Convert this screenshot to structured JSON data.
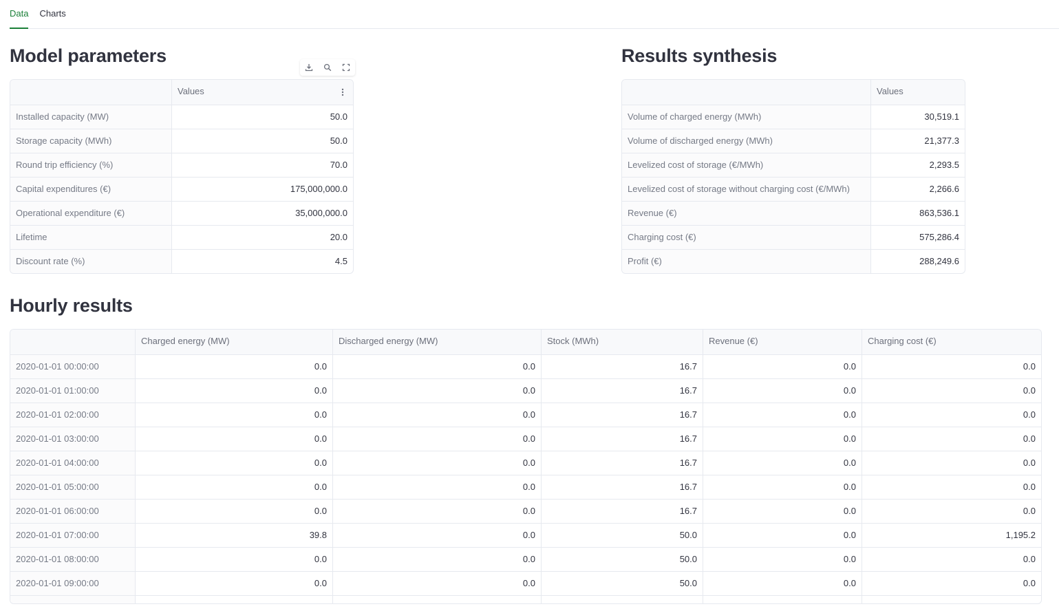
{
  "tabs": [
    {
      "label": "Data",
      "active": true
    },
    {
      "label": "Charts",
      "active": false
    }
  ],
  "accent_color": "#1a7f37",
  "model_parameters": {
    "title": "Model parameters",
    "header": [
      "",
      "Values"
    ],
    "rows": [
      {
        "label": "Installed capacity (MW)",
        "value": "50.0"
      },
      {
        "label": "Storage capacity (MWh)",
        "value": "50.0"
      },
      {
        "label": "Round trip efficiency (%)",
        "value": "70.0"
      },
      {
        "label": "Capital expenditures (€)",
        "value": "175,000,000.0"
      },
      {
        "label": "Operational expenditure (€)",
        "value": "35,000,000.0"
      },
      {
        "label": "Lifetime",
        "value": "20.0"
      },
      {
        "label": "Discount rate (%)",
        "value": "4.5"
      }
    ],
    "toolbar_icons": [
      "download-icon",
      "search-icon",
      "fullscreen-icon"
    ]
  },
  "results_synthesis": {
    "title": "Results synthesis",
    "header": [
      "",
      "Values"
    ],
    "rows": [
      {
        "label": "Volume of charged energy (MWh)",
        "value": "30,519.1"
      },
      {
        "label": "Volume of discharged energy (MWh)",
        "value": "21,377.3"
      },
      {
        "label": "Levelized cost of storage (€/MWh)",
        "value": "2,293.5"
      },
      {
        "label": "Levelized cost of storage without charging cost (€/MWh)",
        "value": "2,266.6"
      },
      {
        "label": "Revenue (€)",
        "value": "863,536.1"
      },
      {
        "label": "Charging cost (€)",
        "value": "575,286.4"
      },
      {
        "label": "Profit (€)",
        "value": "288,249.6"
      }
    ]
  },
  "hourly_results": {
    "title": "Hourly results",
    "columns": [
      "",
      "Charged energy (MW)",
      "Discharged energy (MW)",
      "Stock (MWh)",
      "Revenue (€)",
      "Charging cost (€)"
    ],
    "rows": [
      [
        "2020-01-01 00:00:00",
        "0.0",
        "0.0",
        "16.7",
        "0.0",
        "0.0"
      ],
      [
        "2020-01-01 01:00:00",
        "0.0",
        "0.0",
        "16.7",
        "0.0",
        "0.0"
      ],
      [
        "2020-01-01 02:00:00",
        "0.0",
        "0.0",
        "16.7",
        "0.0",
        "0.0"
      ],
      [
        "2020-01-01 03:00:00",
        "0.0",
        "0.0",
        "16.7",
        "0.0",
        "0.0"
      ],
      [
        "2020-01-01 04:00:00",
        "0.0",
        "0.0",
        "16.7",
        "0.0",
        "0.0"
      ],
      [
        "2020-01-01 05:00:00",
        "0.0",
        "0.0",
        "16.7",
        "0.0",
        "0.0"
      ],
      [
        "2020-01-01 06:00:00",
        "0.0",
        "0.0",
        "16.7",
        "0.0",
        "0.0"
      ],
      [
        "2020-01-01 07:00:00",
        "39.8",
        "0.0",
        "50.0",
        "0.0",
        "1,195.2"
      ],
      [
        "2020-01-01 08:00:00",
        "0.0",
        "0.0",
        "50.0",
        "0.0",
        "0.0"
      ],
      [
        "2020-01-01 09:00:00",
        "0.0",
        "0.0",
        "50.0",
        "0.0",
        "0.0"
      ],
      [
        "",
        "",
        "",
        "",
        "",
        ""
      ]
    ]
  }
}
